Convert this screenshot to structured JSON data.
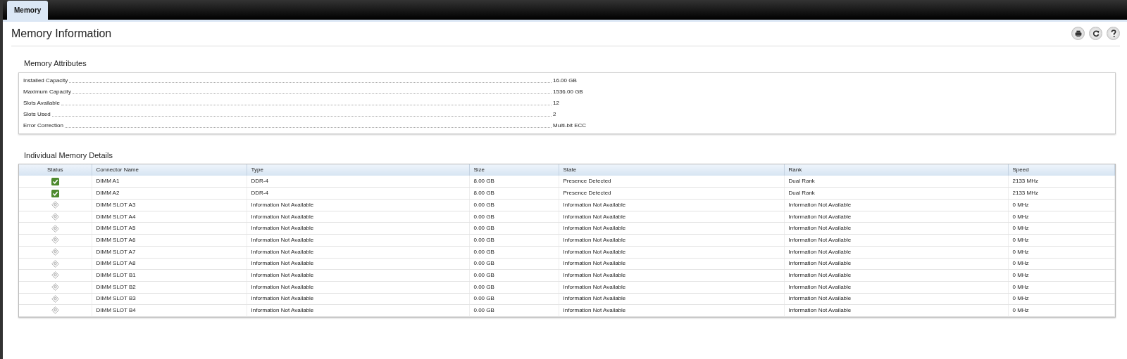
{
  "tabs": [
    {
      "label": "Memory",
      "selected": true
    }
  ],
  "page": {
    "title": "Memory Information"
  },
  "toolbar": [
    {
      "kind": "print"
    },
    {
      "kind": "refresh"
    },
    {
      "kind": "help"
    }
  ],
  "attributes": {
    "title": "Memory Attributes",
    "items": [
      {
        "label": "Installed Capacity",
        "value": "16.00 GB"
      },
      {
        "label": "Maximum Capacity",
        "value": "1536.00 GB"
      },
      {
        "label": "Slots Available",
        "value": "12"
      },
      {
        "label": "Slots Used",
        "value": "2"
      },
      {
        "label": "Error Correction",
        "value": "Multi-bit ECC"
      }
    ]
  },
  "details": {
    "title": "Individual Memory Details",
    "columns": [
      "Status",
      "Connector Name",
      "Type",
      "Size",
      "State",
      "Rank",
      "Speed"
    ],
    "rows": [
      {
        "status": {
          "kind": "ok"
        },
        "connector_name": "DIMM A1",
        "type": "DDR-4",
        "size": "8.00 GB",
        "state": "Presence Detected",
        "rank": "Dual Rank",
        "speed": "2133 MHz"
      },
      {
        "status": {
          "kind": "ok"
        },
        "connector_name": "DIMM A2",
        "type": "DDR-4",
        "size": "8.00 GB",
        "state": "Presence Detected",
        "rank": "Dual Rank",
        "speed": "2133 MHz"
      },
      {
        "status": {
          "kind": "unknown"
        },
        "connector_name": "DIMM SLOT A3",
        "type": "Information Not Available",
        "size": "0.00 GB",
        "state": "Information Not Available",
        "rank": "Information Not Available",
        "speed": "0 MHz"
      },
      {
        "status": {
          "kind": "unknown"
        },
        "connector_name": "DIMM SLOT A4",
        "type": "Information Not Available",
        "size": "0.00 GB",
        "state": "Information Not Available",
        "rank": "Information Not Available",
        "speed": "0 MHz"
      },
      {
        "status": {
          "kind": "unknown"
        },
        "connector_name": "DIMM SLOT A5",
        "type": "Information Not Available",
        "size": "0.00 GB",
        "state": "Information Not Available",
        "rank": "Information Not Available",
        "speed": "0 MHz"
      },
      {
        "status": {
          "kind": "unknown"
        },
        "connector_name": "DIMM SLOT A6",
        "type": "Information Not Available",
        "size": "0.00 GB",
        "state": "Information Not Available",
        "rank": "Information Not Available",
        "speed": "0 MHz"
      },
      {
        "status": {
          "kind": "unknown"
        },
        "connector_name": "DIMM SLOT A7",
        "type": "Information Not Available",
        "size": "0.00 GB",
        "state": "Information Not Available",
        "rank": "Information Not Available",
        "speed": "0 MHz"
      },
      {
        "status": {
          "kind": "unknown"
        },
        "connector_name": "DIMM SLOT A8",
        "type": "Information Not Available",
        "size": "0.00 GB",
        "state": "Information Not Available",
        "rank": "Information Not Available",
        "speed": "0 MHz"
      },
      {
        "status": {
          "kind": "unknown"
        },
        "connector_name": "DIMM SLOT B1",
        "type": "Information Not Available",
        "size": "0.00 GB",
        "state": "Information Not Available",
        "rank": "Information Not Available",
        "speed": "0 MHz"
      },
      {
        "status": {
          "kind": "unknown"
        },
        "connector_name": "DIMM SLOT B2",
        "type": "Information Not Available",
        "size": "0.00 GB",
        "state": "Information Not Available",
        "rank": "Information Not Available",
        "speed": "0 MHz"
      },
      {
        "status": {
          "kind": "unknown"
        },
        "connector_name": "DIMM SLOT B3",
        "type": "Information Not Available",
        "size": "0.00 GB",
        "state": "Information Not Available",
        "rank": "Information Not Available",
        "speed": "0 MHz"
      },
      {
        "status": {
          "kind": "unknown"
        },
        "connector_name": "DIMM SLOT B4",
        "type": "Information Not Available",
        "size": "0.00 GB",
        "state": "Information Not Available",
        "rank": "Information Not Available",
        "speed": "0 MHz"
      }
    ]
  }
}
